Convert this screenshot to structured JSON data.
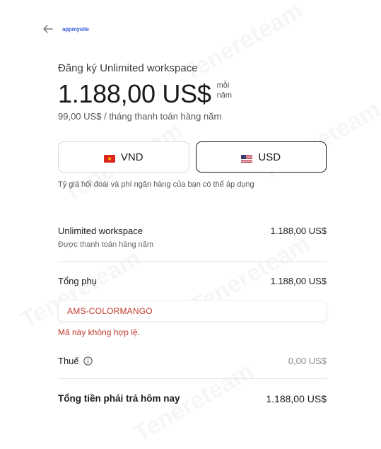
{
  "header": {
    "logo_text": "appmysite"
  },
  "plan": {
    "title": "Đăng ký Unlimited workspace",
    "price": "1.188,00 US$",
    "per_line1": "mỗi",
    "per_line2": "năm",
    "billing_note": "99,00 US$ / tháng thanh toán hàng năm"
  },
  "currency": {
    "options": [
      {
        "label": "VND",
        "flag": "vietnam-flag-icon"
      },
      {
        "label": "USD",
        "flag": "us-flag-icon"
      }
    ],
    "selected": "USD",
    "note": "Tỷ giá hối đoái và phí ngân hàng của bạn có thể áp dụng"
  },
  "summary": {
    "item_label": "Unlimited workspace",
    "item_value": "1.188,00 US$",
    "item_sub": "Được thanh toán hàng năm",
    "subtotal_label": "Tổng phụ",
    "subtotal_value": "1.188,00 US$",
    "coupon_value": "AMS-COLORMANGO",
    "coupon_error": "Mã này không hợp lệ.",
    "tax_label": "Thuế",
    "tax_value": "0,00 US$",
    "total_label": "Tổng tiền phải trả hôm nay",
    "total_value": "1.188,00 US$"
  },
  "watermark": "Tenereteam",
  "colors": {
    "error": "#c0392b",
    "logo": "#3b5bdb",
    "border": "#d9d9d9"
  }
}
